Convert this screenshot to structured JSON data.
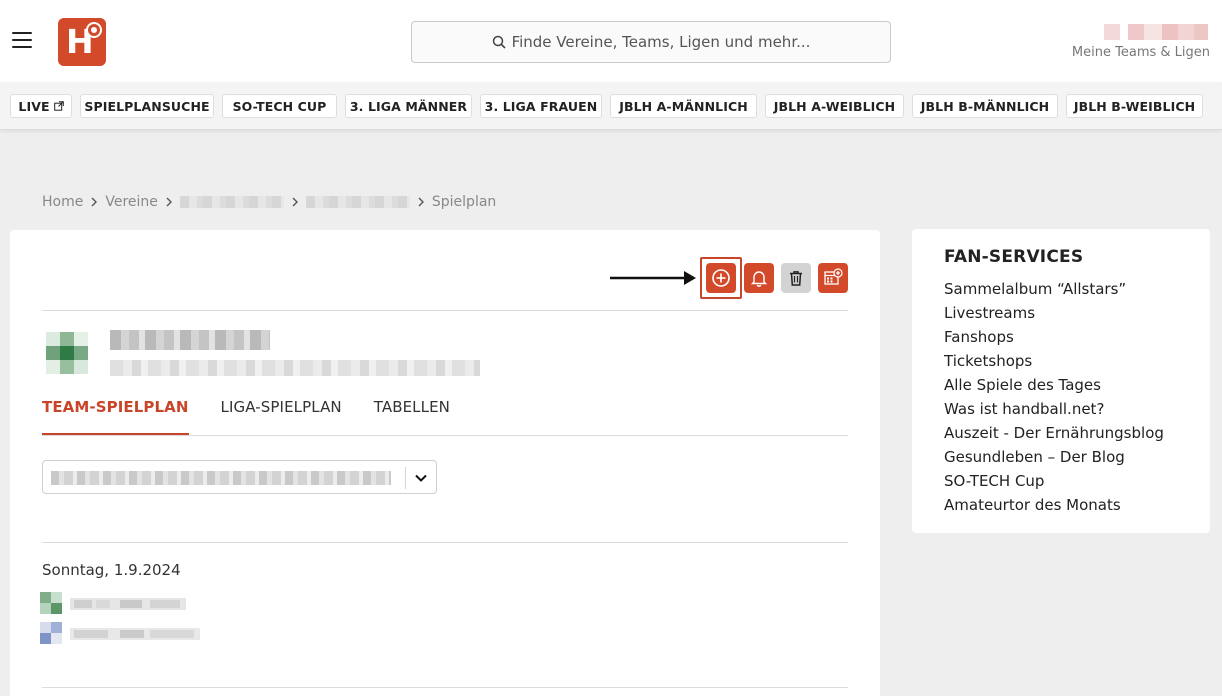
{
  "header": {
    "search_placeholder": "Finde Vereine, Teams, Ligen und mehr...",
    "my_teams_label": "Meine Teams & Ligen",
    "logo_letter": "H"
  },
  "nav": {
    "items": [
      {
        "label": "LIVE"
      },
      {
        "label": "SPIELPLANSUCHE"
      },
      {
        "label": "SO-TECH CUP"
      },
      {
        "label": "3. LIGA MÄNNER"
      },
      {
        "label": "3. LIGA FRAUEN"
      },
      {
        "label": "JBLH A-MÄNNLICH"
      },
      {
        "label": "JBLH A-WEIBLICH"
      },
      {
        "label": "JBLH B-MÄNNLICH"
      },
      {
        "label": "JBLH B-WEIBLICH"
      }
    ]
  },
  "breadcrumb": {
    "home": "Home",
    "vereine": "Vereine",
    "current": "Spielplan"
  },
  "main": {
    "tabs": [
      {
        "label": "TEAM-SPIELPLAN"
      },
      {
        "label": "LIGA-SPIELPLAN"
      },
      {
        "label": "TABELLEN"
      }
    ],
    "date_heading": "Sonntag, 1.9.2024"
  },
  "sidebar": {
    "title": "FAN-SERVICES",
    "items": [
      {
        "label": "Sammelalbum “Allstars”"
      },
      {
        "label": "Livestreams"
      },
      {
        "label": "Fanshops"
      },
      {
        "label": "Ticketshops"
      },
      {
        "label": "Alle Spiele des Tages"
      },
      {
        "label": "Was ist handball.net?"
      },
      {
        "label": "Auszeit - Der Ernährungsblog"
      },
      {
        "label": "Gesundleben – Der Blog"
      },
      {
        "label": "SO-TECH Cup"
      },
      {
        "label": "Amateurtor des Monats"
      }
    ]
  },
  "colors": {
    "brand": "#d24a2a",
    "page_bg": "#eeeeee"
  },
  "icons": [
    "menu-icon",
    "search-icon",
    "external-link-icon",
    "chevron-right-icon",
    "plus-circle-icon",
    "bell-icon",
    "trash-icon",
    "calendar-add-icon",
    "chevron-down-icon",
    "arrow-right-icon"
  ]
}
